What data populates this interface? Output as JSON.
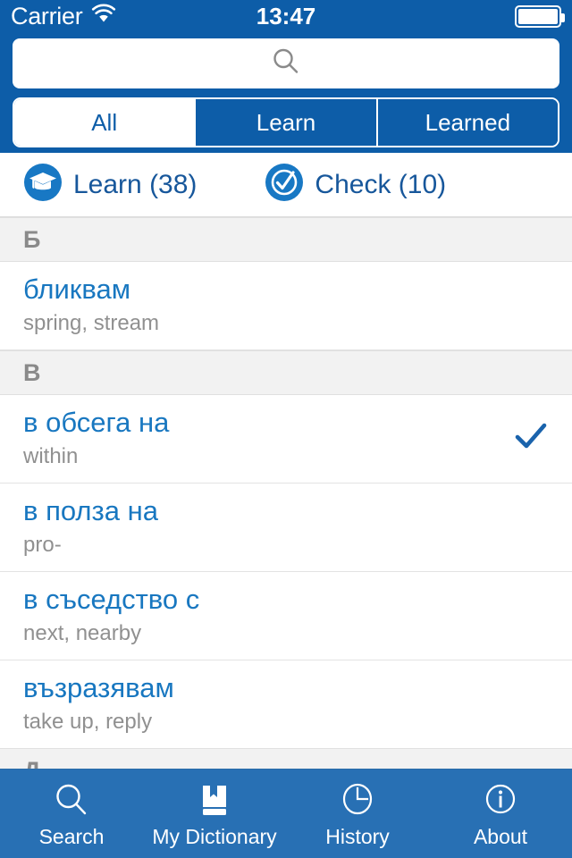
{
  "status_bar": {
    "carrier": "Carrier",
    "wifi_icon": "wifi-icon",
    "time": "13:47",
    "battery_icon": "battery-full-icon"
  },
  "search": {
    "value": "",
    "placeholder": "",
    "icon": "search-icon"
  },
  "segmented_control": {
    "selected": "All",
    "options": [
      {
        "label": "All",
        "selected": true
      },
      {
        "label": "Learn",
        "selected": false
      },
      {
        "label": "Learned",
        "selected": false
      }
    ]
  },
  "action_bar": {
    "learn": {
      "label": "Learn (38)",
      "icon": "graduation-cap-icon",
      "count": 38
    },
    "check": {
      "label": "Check (10)",
      "icon": "check-circle-icon",
      "count": 10
    }
  },
  "list": {
    "sections": [
      {
        "letter": "Б",
        "entries": [
          {
            "word": "бликвам",
            "translation": "spring, stream",
            "checked": false
          }
        ]
      },
      {
        "letter": "В",
        "entries": [
          {
            "word": "в обсега на",
            "translation": "within",
            "checked": true
          },
          {
            "word": "в полза на",
            "translation": "pro-",
            "checked": false
          },
          {
            "word": "в съседство с",
            "translation": "next, nearby",
            "checked": false
          },
          {
            "word": "възразявам",
            "translation": "take up, reply",
            "checked": false
          }
        ]
      },
      {
        "letter": "Д",
        "entries": []
      }
    ]
  },
  "tab_bar": {
    "tabs": [
      {
        "label": "Search",
        "icon": "search-icon"
      },
      {
        "label": "My Dictionary",
        "icon": "book-bookmark-icon"
      },
      {
        "label": "History",
        "icon": "clock-icon"
      },
      {
        "label": "About",
        "icon": "info-circle-icon"
      }
    ]
  },
  "colors": {
    "header_blue": "#0d5da8",
    "tabbar_blue": "#2870b4",
    "word_blue": "#1877c0",
    "action_blue": "#17579b",
    "section_bg": "#f2f2f2",
    "translation_gray": "#909090"
  }
}
